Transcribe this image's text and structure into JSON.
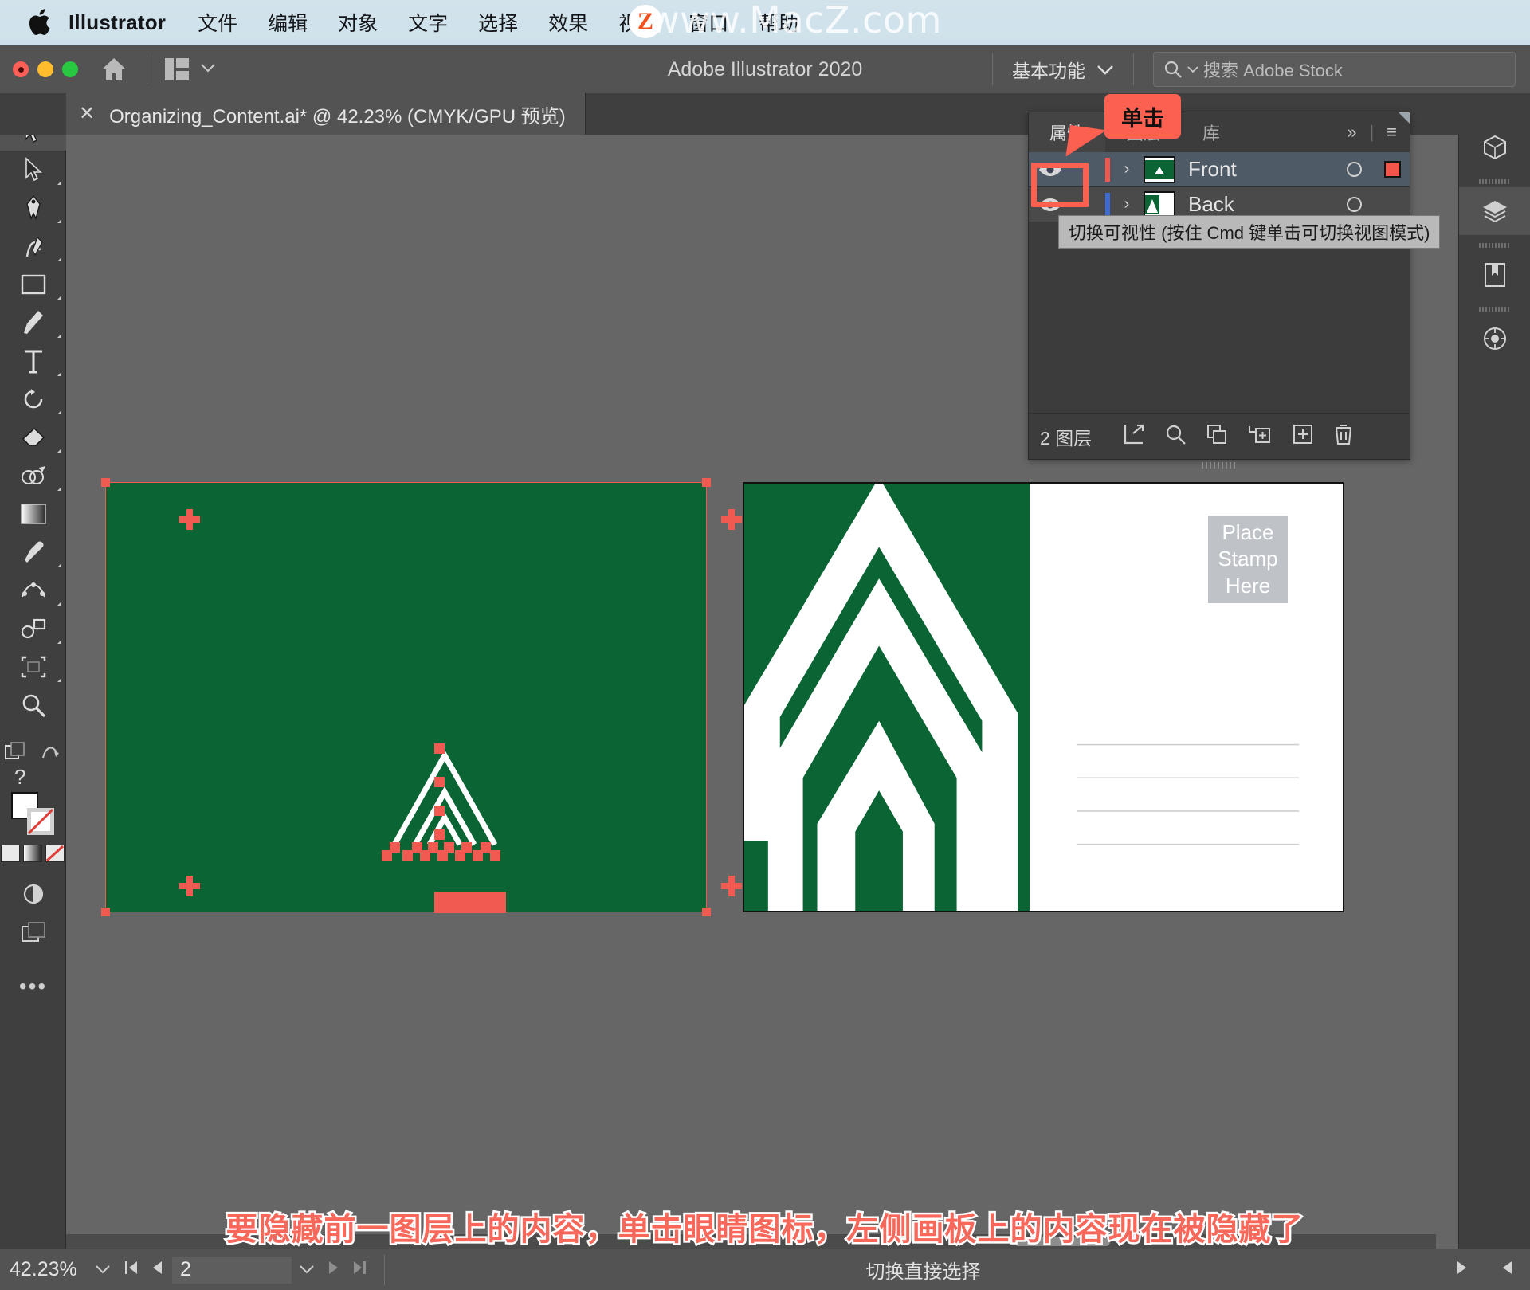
{
  "macbar": {
    "app_name": "Illustrator",
    "menus": [
      "文件",
      "编辑",
      "对象",
      "文字",
      "选择",
      "效果",
      "视图",
      "窗口",
      "帮助"
    ],
    "watermark": "www.MacZ.com",
    "watermark_badge": "Z"
  },
  "titlebar": {
    "title": "Adobe Illustrator 2020",
    "workspace": "基本功能",
    "search_placeholder": "搜索 Adobe Stock"
  },
  "tab": {
    "close": "✕",
    "title": "Organizing_Content.ai* @ 42.23% (CMYK/GPU 预览)"
  },
  "toolbar": {
    "tools": [
      "selection-tool",
      "direct-selection-tool",
      "pen-tool",
      "curvature-tool",
      "rectangle-tool",
      "paintbrush-tool",
      "type-tool",
      "rotate-tool",
      "eraser-tool",
      "shape-builder-tool",
      "gradient-tool",
      "eyedropper-tool",
      "blend-tool",
      "symbol-sprayer-tool",
      "artboard-tool",
      "zoom-tool"
    ],
    "more_label": "•••",
    "question_mark": "?"
  },
  "panel": {
    "tabs": [
      {
        "label": "属性",
        "active": true
      },
      {
        "label": "图层",
        "active": false
      },
      {
        "label": "库",
        "active": false
      }
    ],
    "expand_icon": "»",
    "menu_icon": "≡",
    "layers": [
      {
        "name": "Front",
        "color": "#f4564c",
        "selected": true,
        "visible": true
      },
      {
        "name": "Back",
        "color": "#3d6ad6",
        "selected": false,
        "visible": true
      }
    ],
    "footer_count": "2 图层",
    "footer_icons": [
      "locate-object-icon",
      "search-icon",
      "duplicate-layer-icon",
      "collect-into-new-layer-icon",
      "new-layer-icon",
      "delete-layer-icon"
    ]
  },
  "callout": {
    "label": "单击",
    "tooltip": "切换可视性 (按住 Cmd 键单击可切换视图模式)"
  },
  "artwork": {
    "left_artboard_bg": "#0b6434",
    "right_artboard_bg": "#0b6434",
    "stamp_lines": [
      "Place",
      "Stamp",
      "Here"
    ],
    "selection_color": "#f05a50"
  },
  "statusbar": {
    "zoom": "42.23%",
    "page": "2",
    "tool_label": "切换直接选择"
  },
  "caption": "要隐藏前一图层上的内容，单击眼睛图标，左侧画板上的内容现在被隐藏了"
}
